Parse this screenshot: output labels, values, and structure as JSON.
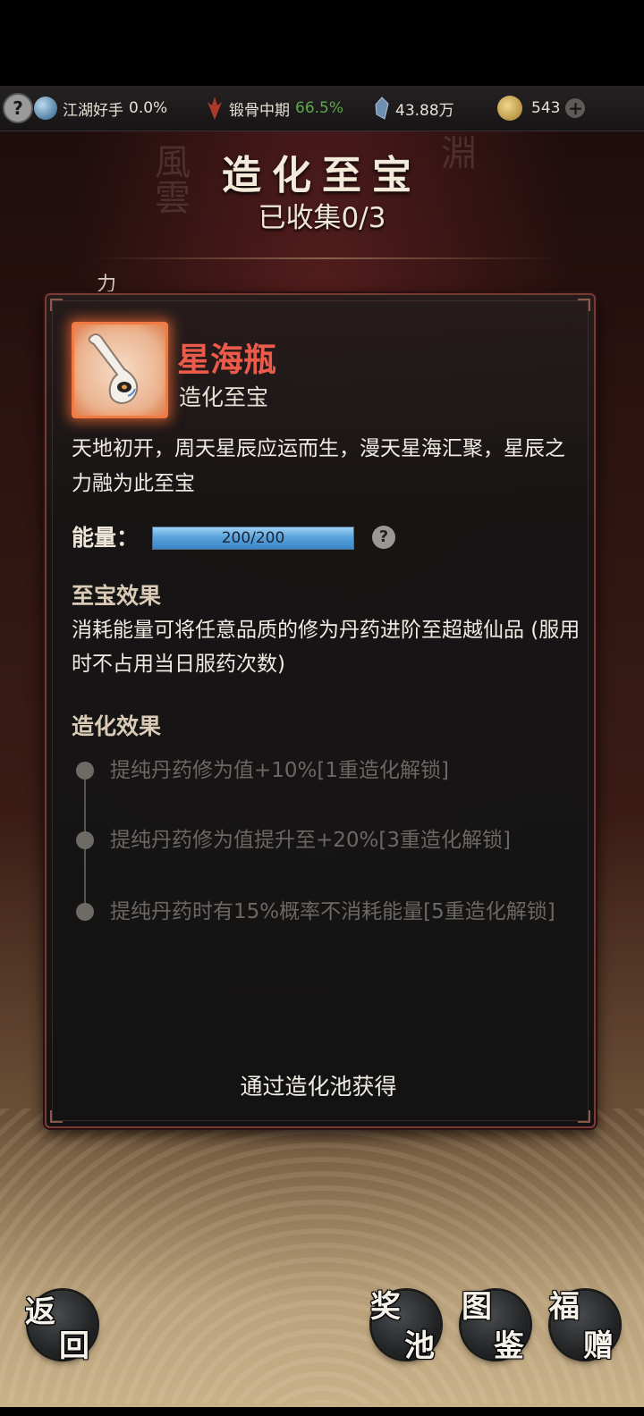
{
  "statusbar": {
    "rank_label": "江湖好手",
    "rank_percent": "0.0%",
    "realm_label": "锻骨中期",
    "realm_percent": "66.5%",
    "spirit_amount": "43.88万",
    "coin_amount": "543",
    "icons": [
      "help-icon",
      "taiji-icon",
      "rank-emblem-icon",
      "spirit-stone-icon",
      "gold-coin-icon",
      "plus-icon"
    ]
  },
  "header": {
    "title": "造化至宝",
    "collected": "已收集0/3",
    "partial_text": "力"
  },
  "card": {
    "item_name": "星海瓶",
    "item_type": "造化至宝",
    "description": "天地初开，周天星辰应运而生，漫天星海汇聚，星辰之力融为此至宝",
    "energy_label": "能量：",
    "energy_text": "200/200",
    "energy_fraction": 1.0,
    "treasure_effect_title": "至宝效果",
    "treasure_effect_body": "消耗能量可将任意品质的修为丹药进阶至超越仙品 (服用时不占用当日服药次数)",
    "creation_effect_title": "造化效果",
    "creation_effects": [
      "提纯丹药修为值+10%[1重造化解锁]",
      "提纯丹药修为值提升至+20%[3重造化解锁]",
      "提纯丹药时有15%概率不消耗能量[5重造化解锁]"
    ],
    "obtain_text": "通过造化池获得"
  },
  "bottom_buttons": {
    "back": [
      "返",
      "回"
    ],
    "prize_pool": [
      "奖",
      "池"
    ],
    "codex": [
      "图",
      "鉴"
    ],
    "gift": [
      "福",
      "赠"
    ]
  },
  "colors": {
    "item_name": "#ec5a4a",
    "realm_percent": "#5fa84a",
    "card_border": "#7a3a34",
    "energy_fill": "#5aa4dc"
  }
}
